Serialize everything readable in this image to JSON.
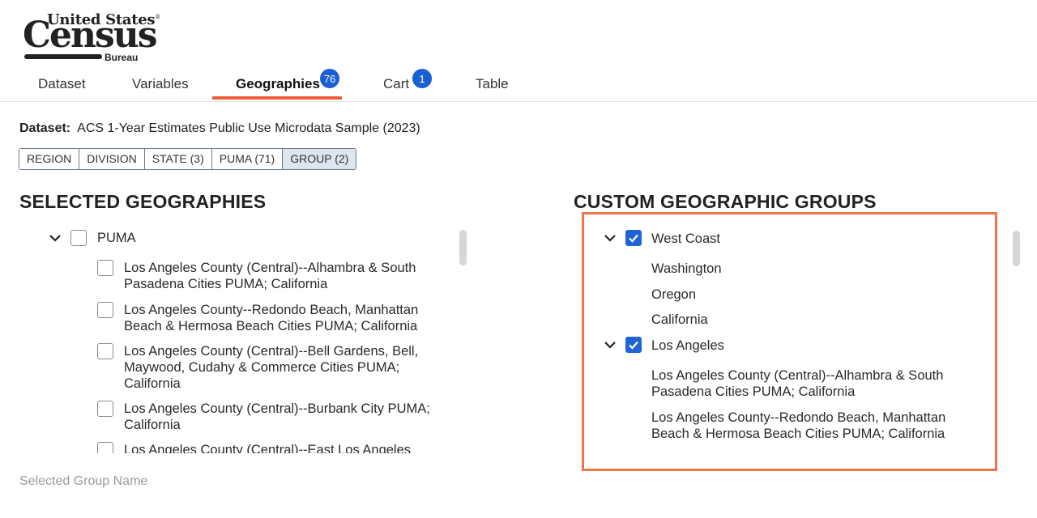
{
  "logo": {
    "line1": "United States",
    "trademark": "®",
    "line2": "Census",
    "line3": "Bureau"
  },
  "tabs": [
    {
      "label": "Dataset"
    },
    {
      "label": "Variables"
    },
    {
      "label": "Geographies",
      "badge": "76",
      "active": true
    },
    {
      "label": "Cart",
      "badge": "1"
    },
    {
      "label": "Table"
    }
  ],
  "dataset": {
    "label": "Dataset:",
    "value": "ACS 1-Year Estimates Public Use Microdata Sample (2023)"
  },
  "filters": [
    "REGION",
    "DIVISION",
    "STATE (3)",
    "PUMA (71)",
    "GROUP (2)"
  ],
  "selected": {
    "heading": "SELECTED GEOGRAPHIES",
    "parent": "PUMA",
    "items": [
      {
        "line1": "Los Angeles County (Central)--Alhambra & South",
        "line2": "Pasadena Cities PUMA; California"
      },
      {
        "line1": "Los Angeles County--Redondo Beach, Manhattan",
        "line2": "Beach & Hermosa Beach Cities PUMA; California"
      },
      {
        "line1": "Los Angeles County (Central)--Bell Gardens, Bell,",
        "line2": "Maywood, Cudahy & Commerce Cities PUMA;",
        "line3": "California"
      },
      {
        "line1": "Los Angeles County (Central)--Burbank City PUMA;",
        "line2": "California"
      },
      {
        "line1": "Los Angeles County (Central)--East Los Angeles"
      }
    ]
  },
  "custom": {
    "heading": "CUSTOM GEOGRAPHIC GROUPS",
    "groups": [
      {
        "name": "West Coast",
        "members": [
          "Washington",
          "Oregon",
          "California"
        ]
      },
      {
        "name": "Los Angeles",
        "members": [
          {
            "line1": "Los Angeles County (Central)--Alhambra & South",
            "line2": "Pasadena Cities PUMA; California"
          },
          {
            "line1": "Los Angeles County--Redondo Beach, Manhattan",
            "line2": "Beach & Hermosa Beach Cities PUMA; California"
          }
        ]
      }
    ]
  },
  "footer": {
    "group_name_placeholder": "Selected Group Name"
  },
  "colors": {
    "accent": "#ee5d33",
    "badge": "#1a5fd6",
    "checkbox": "#1f64d2",
    "highlight_border": "#ee7547"
  },
  "icons": [
    "chevron-down-icon",
    "check-icon"
  ]
}
